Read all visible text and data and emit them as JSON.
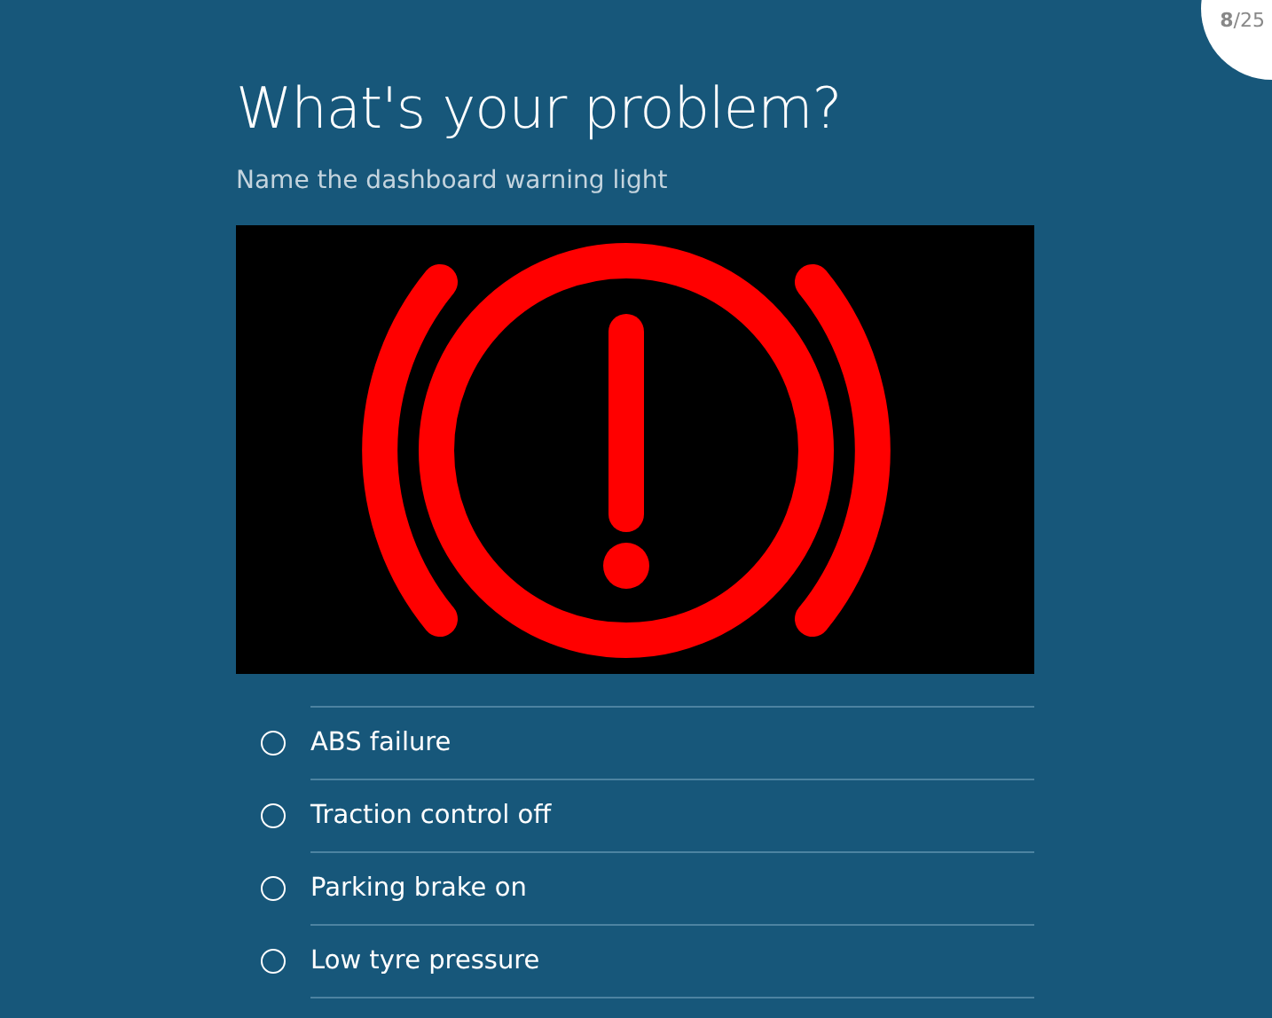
{
  "progress": "**8**/25",
  "question": {
    "title": "What's your problem?",
    "subtitle": "Name the dashboard warning light"
  },
  "options": [
    {
      "label": "ABS failure",
      "selected": false
    },
    {
      "label": "Traction control off",
      "selected": false
    },
    {
      "label": "Parking brake on",
      "selected": false
    },
    {
      "label": "Low tyre pressure",
      "selected": false
    }
  ]
}
